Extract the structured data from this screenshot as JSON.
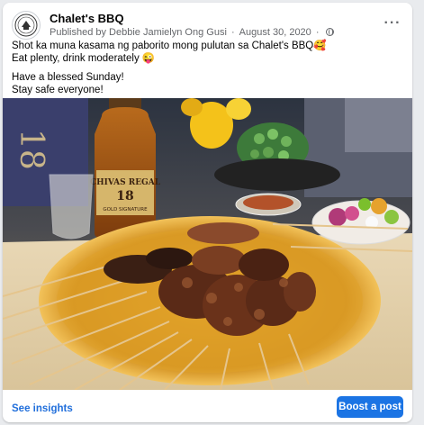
{
  "post": {
    "page_name": "Chalet's BBQ",
    "published_by": "Published by Debbie Jamielyn Ong Gusi",
    "date": "August 30, 2020",
    "more_icon": "more-horizontal-icon",
    "privacy_icon": "globe-icon",
    "message": [
      "Shot ka muna kasama ng paborito mong pulutan sa Chalet's BBQ🥰",
      "Eat plenty, drink moderately 😜",
      "Have a blessed Sunday!",
      "Stay safe everyone!"
    ],
    "photo_texts": {
      "bottle_brand": "CHIVAS REGAL",
      "bottle_age": "18",
      "bottle_sub": "GOLD SIGNATURE",
      "box_text": "18"
    }
  },
  "footer": {
    "insights_label": "See insights",
    "boost_label": "Boost a post"
  },
  "colors": {
    "accent": "#1b74e4",
    "link": "#216fdb",
    "meta_text": "#65676b"
  }
}
